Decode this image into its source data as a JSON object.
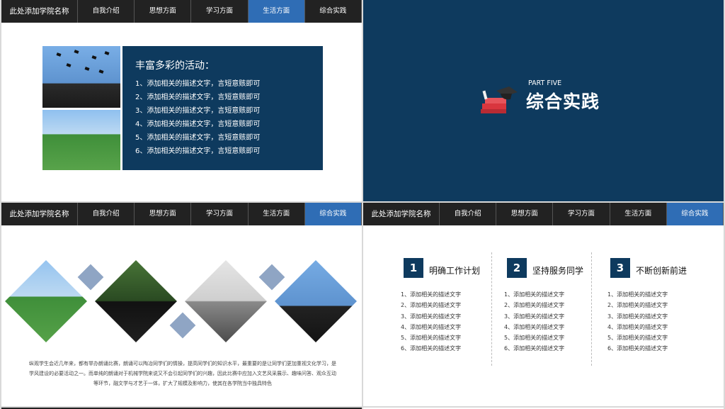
{
  "nav": {
    "brand": "此处添加学院名称",
    "tabs": [
      "自我介绍",
      "思想方面",
      "学习方面",
      "生活方面",
      "综合实践"
    ]
  },
  "slide1": {
    "active_tab": 3,
    "panel_title": "丰富多彩的活动：",
    "items": [
      "1、添加相关的描述文字，言短意赅即可",
      "2、添加相关的描述文字，言短意赅即可",
      "3、添加相关的描述文字，言短意赅即可",
      "4、添加相关的描述文字，言短意赅即可",
      "5、添加相关的描述文字，言短意赅即可",
      "6、添加相关的描述文字，言短意赅即可"
    ]
  },
  "slide2": {
    "part_label": "PART FIVE",
    "title": "综合实践",
    "icon": "books-graduation-cap-icon"
  },
  "slide3": {
    "active_tab": 4,
    "paragraph": "纵观学生会近几年来，都有举办朗诵比赛，朗诵可以陶冶同学们的情操，提高同学们的知识水平，最重要的是让同学们更加重视文化学习，是学风建设的必要活动之一。而单纯的朗诵对于机械学院来说又不会引起同学们的兴趣，因此比赛中应加入文艺风采展示、趣味问答、观众互动等环节，融文学与才艺于一体，扩大了规模及影响力，使其在各学院当中独具特色"
  },
  "slide4": {
    "active_tab": 4,
    "columns": [
      {
        "num": "1",
        "title": "明确工作计划",
        "items": [
          "1、添加相关的描述文字",
          "2、添加相关的描述文字",
          "3、添加相关的描述文字",
          "4、添加相关的描述文字",
          "5、添加相关的描述文字",
          "6、添加相关的描述文字"
        ]
      },
      {
        "num": "2",
        "title": "坚持服务同学",
        "items": [
          "1、添加相关的描述文字",
          "2、添加相关的描述文字",
          "3、添加相关的描述文字",
          "4、添加相关的描述文字",
          "5、添加相关的描述文字",
          "6、添加相关的描述文字"
        ]
      },
      {
        "num": "3",
        "title": "不断创新前进",
        "items": [
          "1、添加相关的描述文字",
          "2、添加相关的描述文字",
          "3、添加相关的描述文字",
          "4、添加相关的描述文字",
          "5、添加相关的描述文字",
          "6、添加相关的描述文字"
        ]
      }
    ]
  },
  "colors": {
    "nav_bg": "#222222",
    "active_tab": "#2f6db5",
    "navy": "#0e3a5e",
    "accent_light": "#8fa5c4"
  }
}
